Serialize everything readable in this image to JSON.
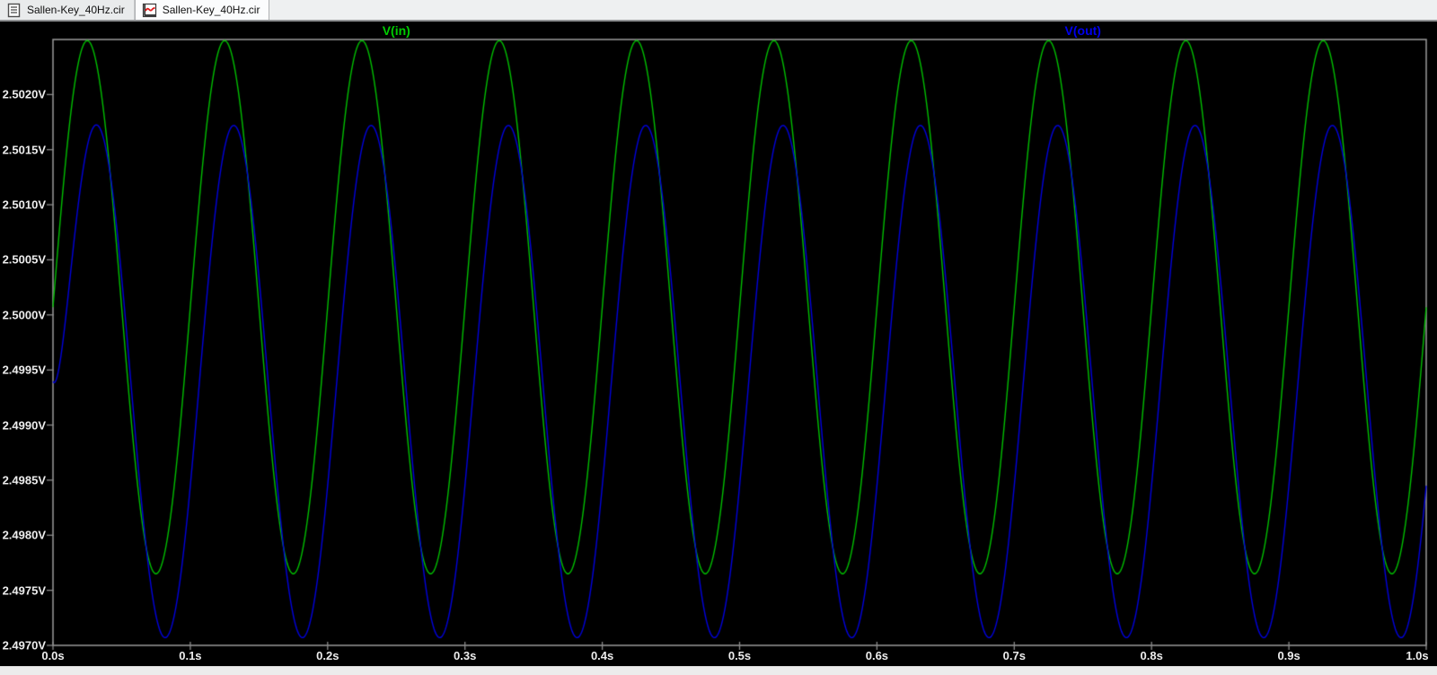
{
  "window": {
    "tabs": [
      {
        "label": "Sallen-Key_40Hz.cir",
        "icon": "netlist-document-icon",
        "active": false
      },
      {
        "label": "Sallen-Key_40Hz.cir",
        "icon": "waveform-plot-icon",
        "active": true
      }
    ]
  },
  "chart_data": {
    "type": "line",
    "title": "",
    "xlabel": "",
    "ylabel": "",
    "grid": false,
    "background": "#000000",
    "axis_color": "#9a9a9a",
    "tick_color": "#8a8a8a",
    "label_color": "#ededed",
    "legend_position": "top",
    "x_range_s": [
      0.0,
      1.0
    ],
    "y_range_v": [
      2.497,
      2.5025
    ],
    "x_ticks": [
      {
        "t": 0.0,
        "label": "0.0s"
      },
      {
        "t": 0.1,
        "label": "0.1s"
      },
      {
        "t": 0.2,
        "label": "0.2s"
      },
      {
        "t": 0.3,
        "label": "0.3s"
      },
      {
        "t": 0.4,
        "label": "0.4s"
      },
      {
        "t": 0.5,
        "label": "0.5s"
      },
      {
        "t": 0.6,
        "label": "0.6s"
      },
      {
        "t": 0.7,
        "label": "0.7s"
      },
      {
        "t": 0.8,
        "label": "0.8s"
      },
      {
        "t": 0.9,
        "label": "0.9s"
      },
      {
        "t": 1.0,
        "label": "1.0s"
      }
    ],
    "y_ticks": [
      {
        "v": 2.502,
        "label": "2.5020V"
      },
      {
        "v": 2.5015,
        "label": "2.5015V"
      },
      {
        "v": 2.501,
        "label": "2.5010V"
      },
      {
        "v": 2.5005,
        "label": "2.5005V"
      },
      {
        "v": 2.5,
        "label": "2.5000V"
      },
      {
        "v": 2.4995,
        "label": "2.4995V"
      },
      {
        "v": 2.499,
        "label": "2.4990V"
      },
      {
        "v": 2.4985,
        "label": "2.4985V"
      },
      {
        "v": 2.498,
        "label": "2.4980V"
      },
      {
        "v": 2.4975,
        "label": "2.4975V"
      },
      {
        "v": 2.497,
        "label": "2.4970V"
      }
    ],
    "series": [
      {
        "name": "V(in)",
        "color": "#00be00",
        "label_color": "#00cc00",
        "waveform": "sine",
        "frequency_hz": 10,
        "center_v": 2.50007,
        "amplitude_v": 0.00242,
        "phase_lag_deg": 0,
        "startup_tau_s": 0,
        "peak_v": 2.5025,
        "trough_v": 2.4976
      },
      {
        "name": "V(out)",
        "color": "#0000dc",
        "label_color": "#0000ee",
        "waveform": "sine",
        "frequency_hz": 10,
        "center_v": 2.499395,
        "amplitude_v": 0.002325,
        "phase_lag_deg": 24,
        "startup_tau_s": 0.006,
        "start_v": 2.4994,
        "peak_v": 2.5017,
        "trough_v": 2.497
      }
    ]
  }
}
